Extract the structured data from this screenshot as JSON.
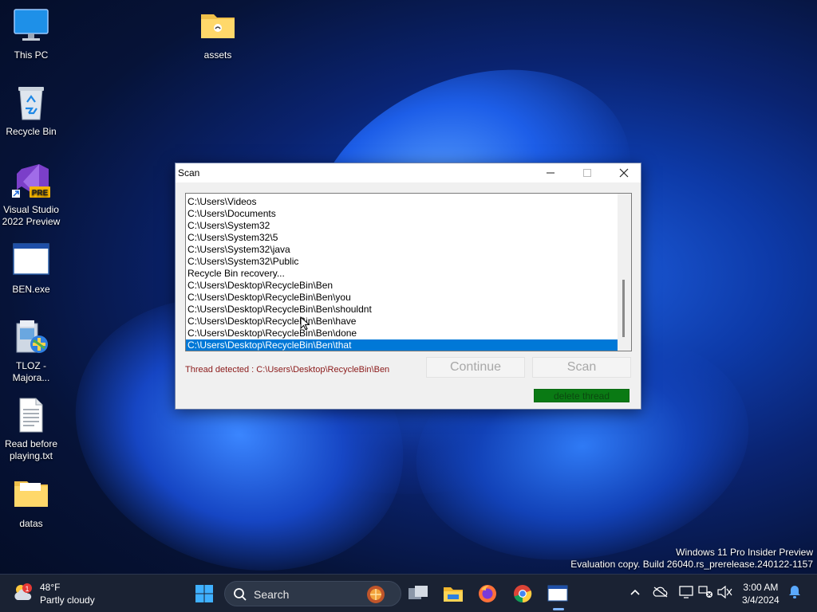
{
  "desktop": {
    "icons": [
      {
        "label": "This PC",
        "icon": "monitor-icon"
      },
      {
        "label": "assets",
        "icon": "folder-icon"
      },
      {
        "label": "Recycle Bin",
        "icon": "recycle-bin-icon"
      },
      {
        "label": "Visual Studio 2022 Preview",
        "icon": "visual-studio-icon",
        "badge": "PRE"
      },
      {
        "label": "BEN.exe",
        "icon": "window-app-icon"
      },
      {
        "label": "TLOZ - Majora...",
        "icon": "installer-icon"
      },
      {
        "label": "Read before playing.txt",
        "icon": "text-file-icon"
      },
      {
        "label": "datas",
        "icon": "folder-icon"
      }
    ]
  },
  "window": {
    "title": "Scan",
    "minimize": "—",
    "maximize": "☐",
    "close": "✕",
    "list_items": [
      "C:\\Users\\Videos",
      "C:\\Users\\Documents",
      "C:\\Users\\System32",
      "C:\\Users\\System32\\5",
      "C:\\Users\\System32\\java",
      "C:\\Users\\System32\\Public",
      "Recycle Bin recovery...",
      "C:\\Users\\Desktop\\RecycleBin\\Ben",
      "C:\\Users\\Desktop\\RecycleBin\\Ben\\you",
      "C:\\Users\\Desktop\\RecycleBin\\Ben\\shouldnt",
      "C:\\Users\\Desktop\\RecycleBin\\Ben\\have",
      "C:\\Users\\Desktop\\RecycleBin\\Ben\\done",
      "C:\\Users\\Desktop\\RecycleBin\\Ben\\that"
    ],
    "selected_item": "C:\\Users\\Desktop\\RecycleBin\\Ben\\that",
    "status": "Thread detected : C:\\Users\\Desktop\\RecycleBin\\Ben",
    "continue_label": "Continue",
    "scan_label": "Scan",
    "delete_label": "delete thread"
  },
  "watermark": {
    "line1": "Windows 11 Pro Insider Preview",
    "line2": "Evaluation copy. Build 26040.rs_prerelease.240122-1157"
  },
  "taskbar": {
    "weather_temp": "48°F",
    "weather_cond": "Partly cloudy",
    "weather_badge": "1",
    "search_placeholder": "Search",
    "time": "3:00 AM",
    "date": "3/4/2024"
  },
  "colors": {
    "selection": "#0078d7",
    "status_text": "#8b1a1a",
    "delete_button": "#0a7a14",
    "taskbar": "#1a2233"
  }
}
